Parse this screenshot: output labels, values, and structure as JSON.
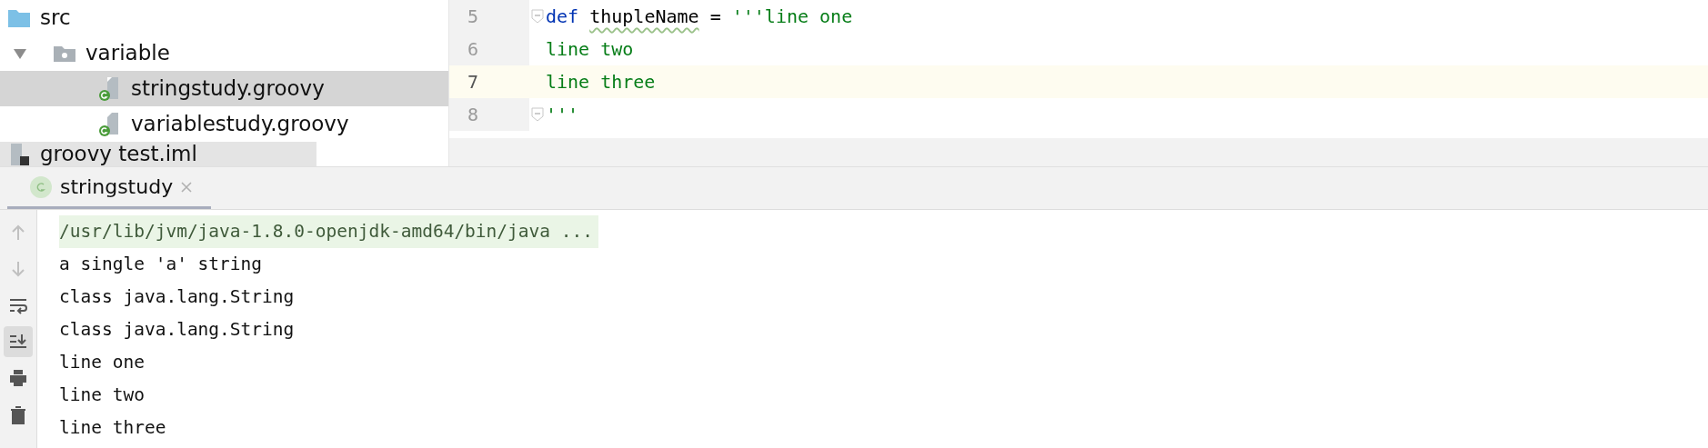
{
  "project_tree": [
    {
      "label": "src",
      "kind": "folder",
      "selected": false,
      "children": [
        {
          "label": "variable",
          "kind": "package",
          "expanded": true,
          "selected": false,
          "children": [
            {
              "label": "stringstudy.groovy",
              "kind": "groovy-file",
              "selected": true
            },
            {
              "label": "variablestudy.groovy",
              "kind": "groovy-file",
              "selected": false
            }
          ]
        }
      ]
    },
    {
      "label": "groovy test.iml",
      "kind": "module-file",
      "selected": false
    }
  ],
  "editor": {
    "lines": [
      {
        "number": "5",
        "current": false,
        "fold": true,
        "tokens": [
          {
            "kind": "keyword",
            "text": "def"
          },
          {
            "kind": "identifier",
            "text": "thupleName",
            "warning": true
          },
          {
            "kind": "plain",
            "text": "="
          },
          {
            "kind": "string",
            "text": "'''line one"
          }
        ]
      },
      {
        "number": "6",
        "current": false,
        "fold": false,
        "tokens": [
          {
            "kind": "string",
            "text": "line two"
          }
        ]
      },
      {
        "number": "7",
        "current": true,
        "fold": false,
        "tokens": [
          {
            "kind": "string",
            "text": "line three"
          }
        ]
      },
      {
        "number": "8",
        "current": false,
        "fold": true,
        "tokens": [
          {
            "kind": "string",
            "text": "'''"
          }
        ]
      }
    ]
  },
  "run_tabs": [
    {
      "label": "stringstudy",
      "selected": true
    }
  ],
  "console": {
    "toolbar": [
      {
        "kind": "up",
        "disabled": true,
        "on": false
      },
      {
        "kind": "down",
        "disabled": true,
        "on": false
      },
      {
        "kind": "wrap",
        "disabled": false,
        "on": false
      },
      {
        "kind": "scroll-end",
        "disabled": false,
        "on": true
      },
      {
        "kind": "print",
        "disabled": false,
        "on": false
      },
      {
        "kind": "trash",
        "disabled": false,
        "on": false
      }
    ],
    "lines": [
      {
        "kind": "command",
        "text": "/usr/lib/jvm/java-1.8.0-openjdk-amd64/bin/java ..."
      },
      {
        "kind": "output",
        "text": "a single 'a' string"
      },
      {
        "kind": "output",
        "text": "class java.lang.String"
      },
      {
        "kind": "output",
        "text": "class java.lang.String"
      },
      {
        "kind": "output",
        "text": "line one"
      },
      {
        "kind": "output",
        "text": "line two"
      },
      {
        "kind": "output",
        "text": "line three"
      }
    ]
  }
}
